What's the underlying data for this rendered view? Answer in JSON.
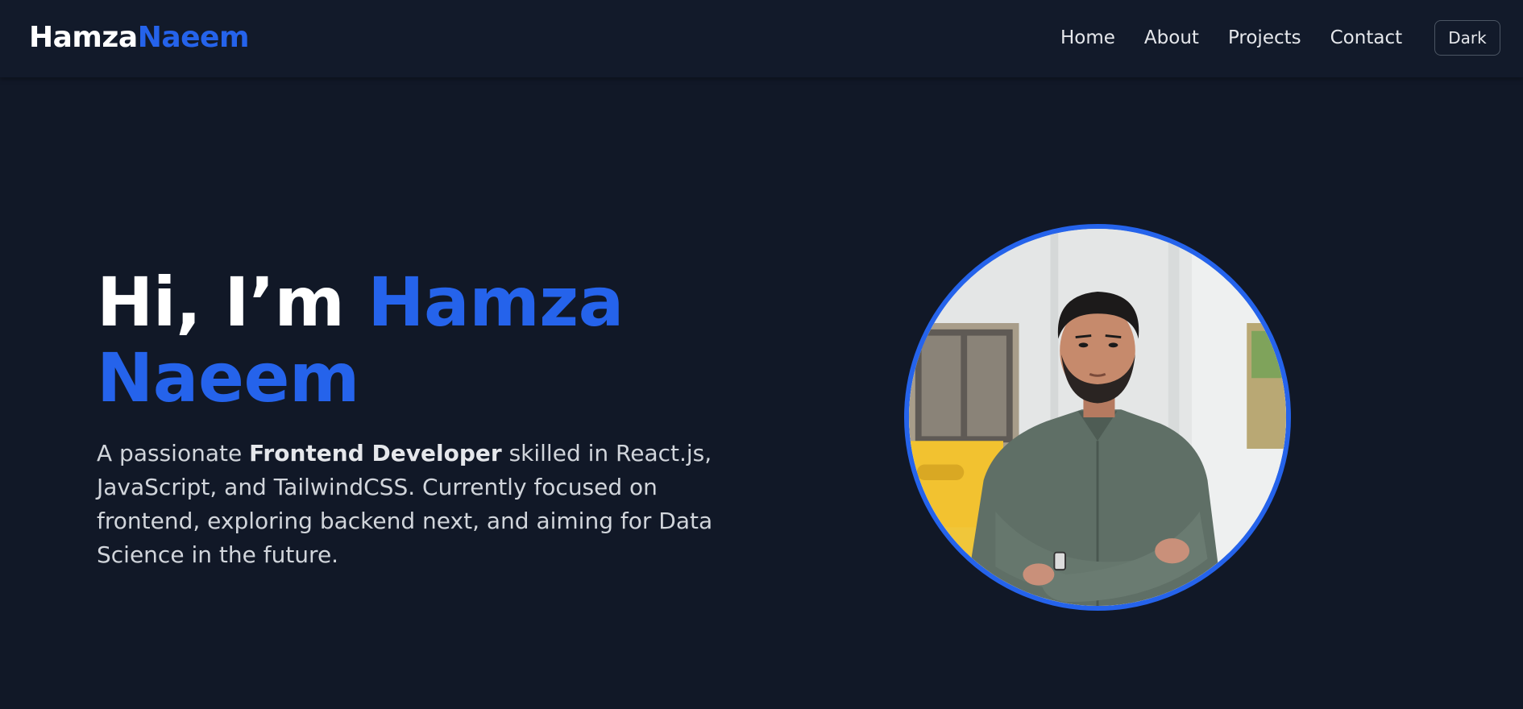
{
  "nav": {
    "logo_first": "Hamza",
    "logo_last": "Naeem",
    "links": [
      "Home",
      "About",
      "Projects",
      "Contact"
    ],
    "theme_button": "Dark"
  },
  "hero": {
    "greeting": "Hi, I’m",
    "name_line1": "Hamza",
    "name_line2": "Naeem",
    "desc_part1": "A passionate ",
    "desc_bold": "Frontend Developer",
    "desc_part2": " skilled in React.js, JavaScript, and TailwindCSS. Currently focused on frontend, exploring backend next, and aiming for Data Science in the future."
  },
  "colors": {
    "background": "#111827",
    "navbar": "#121a2a",
    "accent": "#2563eb",
    "text": "#e5e7eb"
  }
}
